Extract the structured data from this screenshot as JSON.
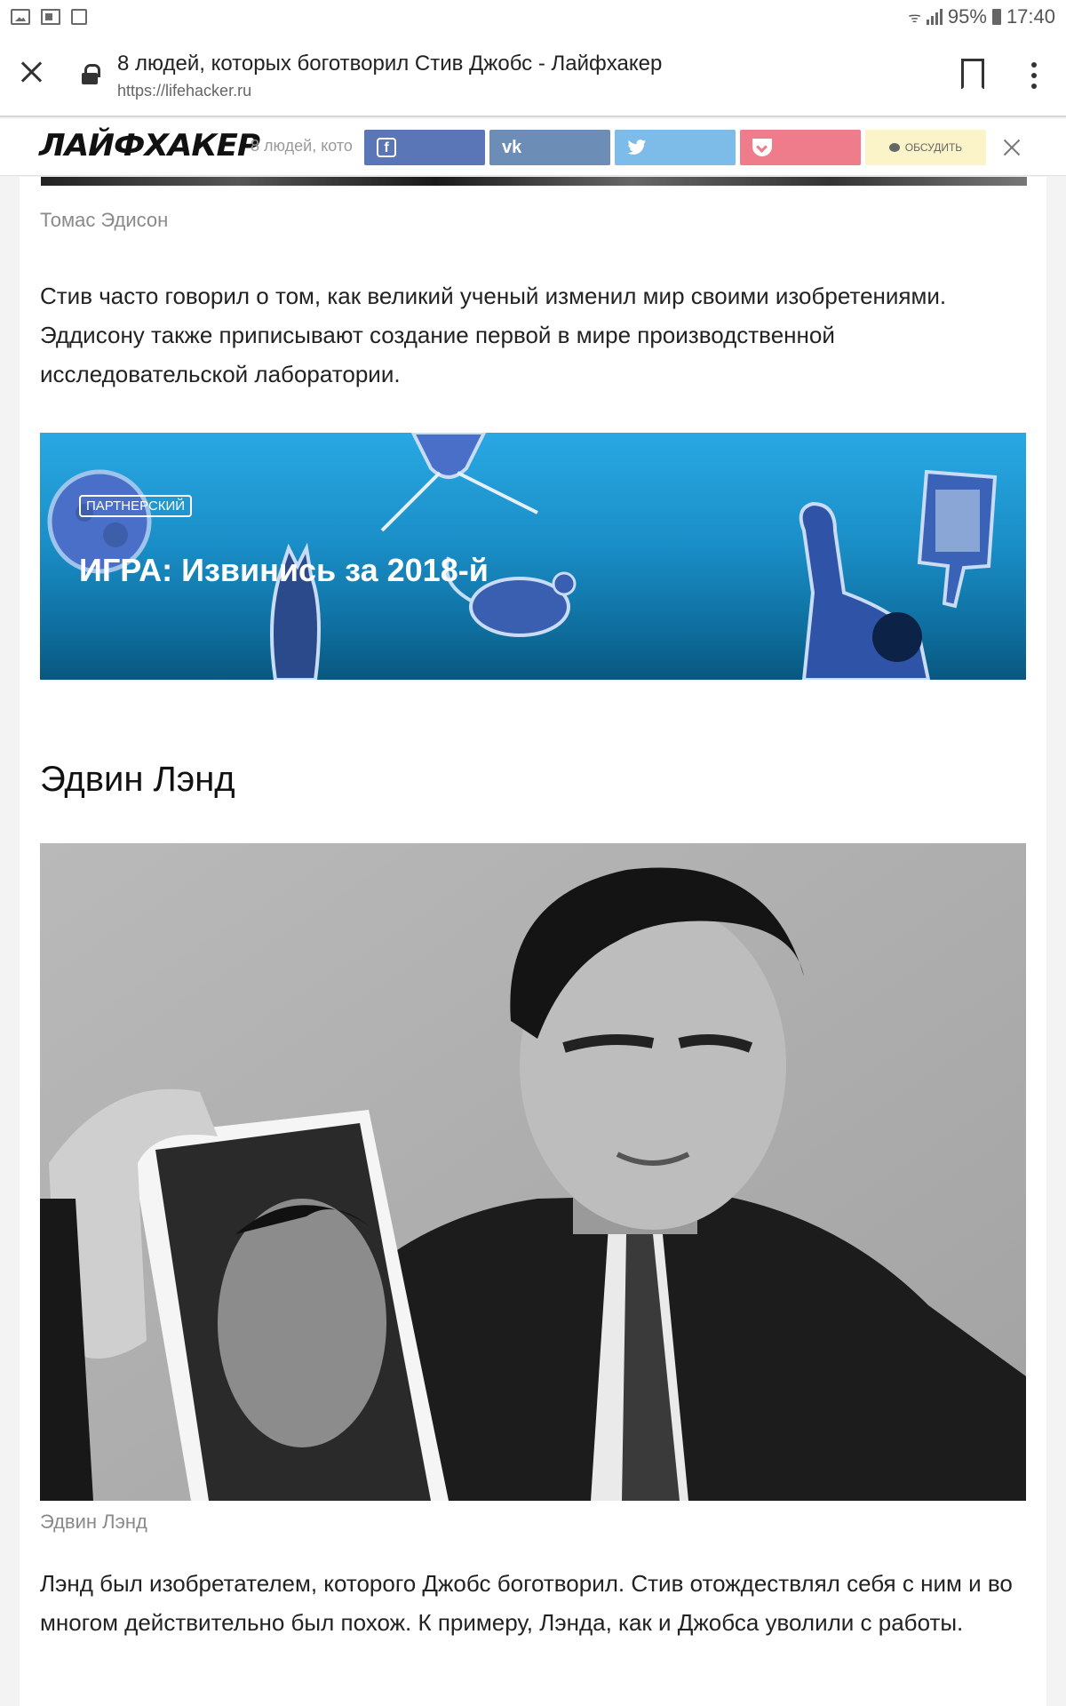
{
  "statusbar": {
    "battery": "95%",
    "time": "17:40"
  },
  "browser": {
    "title": "8 людей, которых боготворил Стив Джобс - Лайфхакер",
    "url": "https://lifehacker.ru"
  },
  "site": {
    "logo": "ЛАЙФХАКЕР",
    "teaser": "8 людей, кото",
    "discuss_label": "ОБСУДИТЬ"
  },
  "article": {
    "caption_edison": "Томас Эдисон",
    "para_edison": "Стив часто говорил о том, как великий ученый изменил мир своими изобретениями. Эддисону также приписывают создание первой в мире производственной исследовательской лаборатории.",
    "promo": {
      "badge": "ПАРТНЕРСКИЙ",
      "title": "ИГРА: Извинись за 2018-й"
    },
    "heading_land": "Эдвин Лэнд",
    "caption_land": "Эдвин Лэнд",
    "para_land": "Лэнд был изобретателем, которого Джобс боготворил. Стив отождествлял себя с ним и во многом действительно был похож. К примеру, Лэнда, как и Джобса уволили с работы."
  }
}
